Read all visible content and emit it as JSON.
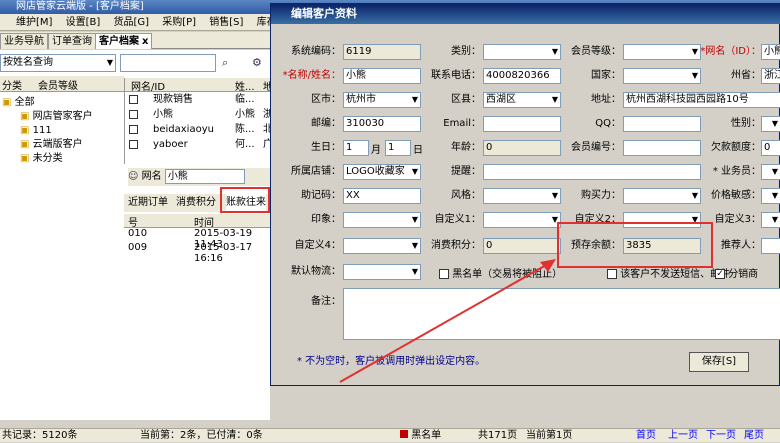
{
  "app": {
    "title": "网店管家云端版 - [客户档案]"
  },
  "menu": [
    "维护[M]",
    "设置[B]",
    "货品[G]",
    "采购[P]",
    "销售[S]",
    "库存[K]"
  ],
  "tabs": [
    "业务导航",
    "订单查询",
    "客户档案"
  ],
  "left": {
    "search_by": "按姓名查询",
    "subtabs": [
      "分类",
      "会员等级"
    ],
    "tree": {
      "root": "全部",
      "children": [
        "网店管家客户",
        "111",
        "云端版客户",
        "未分类"
      ]
    },
    "grid_headers": [
      "网名/ID",
      "姓...",
      "地"
    ],
    "rows": [
      {
        "id": "现款销售",
        "name": "临..."
      },
      {
        "id": "小熊",
        "name": "小熊",
        "loc": "浙"
      },
      {
        "id": "beidaxiaoyu",
        "name": "陈...",
        "loc": "北"
      },
      {
        "id": "yaboer",
        "name": "何...",
        "loc": "广"
      }
    ],
    "netname_label": "网名",
    "netname_value": "小熊",
    "bottom_tabs": [
      "近期订单",
      "消费积分",
      "账款往来"
    ],
    "bottom_headers": [
      "号",
      "时间"
    ],
    "bottom_rows": [
      {
        "no": "010",
        "time": "2015-03-19 11:43"
      },
      {
        "no": "009",
        "time": "2015-03-17 16:16"
      }
    ]
  },
  "dialog": {
    "title": "编辑客户资料",
    "fields": {
      "syscode_l": "系统编码：",
      "syscode": "6119",
      "category_l": "类别：",
      "category": "",
      "level_l": "会员等级：",
      "level": "",
      "netname_l": "*网名（ID）：",
      "netname": "小熊",
      "name_l": "*名称/姓名：",
      "name": "小熊",
      "phone_l": "联系电话：",
      "phone": "4000820366",
      "country_l": "国家：",
      "country": "",
      "state_l": "州省：",
      "state": "浙江",
      "city_l": "区市：",
      "city": "杭州市",
      "district_l": "区县：",
      "district": "西湖区",
      "address_l": "地址：",
      "address": "杭州西湖科技园西园路10号",
      "zip_l": "邮编：",
      "zip": "310030",
      "email_l": "Email：",
      "email": "",
      "qq_l": "QQ：",
      "qq": "",
      "gender_l": "性别：",
      "gender": "",
      "birth_l": "生日：",
      "birth_m": "1",
      "birth_m_unit": "月",
      "birth_d": "1",
      "birth_d_unit": "日",
      "age_l": "年龄：",
      "age": "0",
      "member_no_l": "会员编号：",
      "member_no": "",
      "owed_l": "欠款额度：",
      "owed": "0",
      "shop_l": "所属店铺：",
      "shop": "LOGO收藏家",
      "remind_l": "提醒：",
      "remind": "",
      "staff_l": "* 业务员：",
      "staff": "",
      "mnemonic_l": "助记码：",
      "mnemonic": "XX",
      "style_l": "风格：",
      "style": "",
      "buying_l": "购买力：",
      "buying": "",
      "price_l": "价格敏感：",
      "price": "",
      "impression_l": "印象：",
      "impression": "",
      "custom1_l": "自定义1：",
      "custom1": "",
      "custom2_l": "自定义2：",
      "custom2": "",
      "custom3_l": "自定义3：",
      "custom3": "",
      "custom4_l": "自定义4：",
      "custom4": "",
      "points_l": "消费积分：",
      "points": "0",
      "prepay_l": "预存余额：",
      "prepay": "3835",
      "referrer_l": "推荐人：",
      "referrer": "",
      "logistics_l": "默认物流：",
      "logistics": "",
      "blacklist": "黑名单（交易将被阻止）",
      "no_sms": "该客户不发送短信、邮件",
      "distributor": "分销商",
      "remark_l": "备注：",
      "note": "* 不为空时，客户被调用时弹出设定内容。",
      "save": "保存[S]"
    }
  },
  "status": {
    "records": "共记录：5120条",
    "current": "当前第：2条，已付清：0条",
    "blacklist": "黑名单",
    "pages": "共171页",
    "curpage": "当前第1页",
    "first": "首页",
    "prev": "上一页",
    "next": "下一页",
    "last": "尾页"
  }
}
